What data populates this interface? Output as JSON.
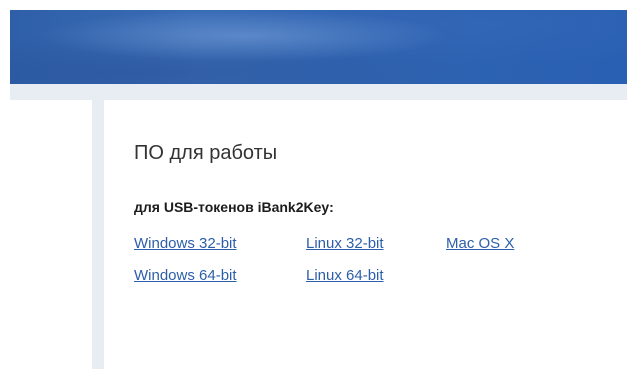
{
  "section": {
    "title": "ПО для работы",
    "subtitle": "для USB-токенов iBank2Key:"
  },
  "downloads": {
    "row1": [
      "Windows 32-bit",
      "Linux 32-bit",
      "Mac OS X"
    ],
    "row2": [
      "Windows 64-bit",
      "Linux 64-bit"
    ]
  },
  "colors": {
    "banner": "#2f63b0",
    "link": "#2d5fa8",
    "sidebar": "#e8edf3"
  }
}
